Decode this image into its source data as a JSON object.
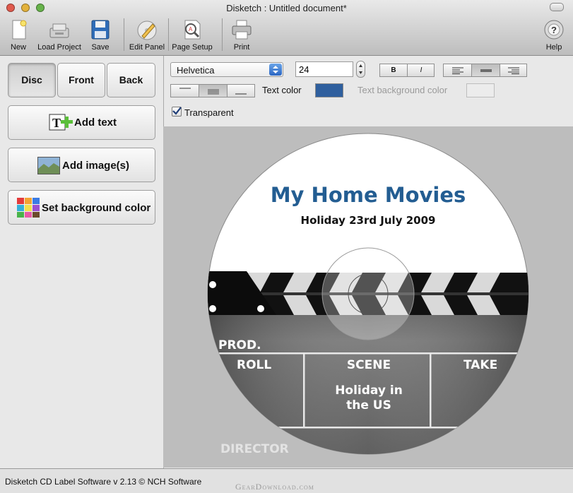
{
  "window": {
    "title": "Disketch : Untitled document*",
    "traffic_colors": [
      "#e05a4d",
      "#e3b23c",
      "#67b34b"
    ]
  },
  "toolbar": {
    "new": {
      "label": "New",
      "icon": "new-document-icon"
    },
    "load": {
      "label": "Load Project",
      "icon": "load-project-icon"
    },
    "save": {
      "label": "Save",
      "icon": "floppy-disk-icon"
    },
    "edit": {
      "label": "Edit Panel",
      "icon": "edit-panel-icon"
    },
    "page_setup": {
      "label": "Page Setup",
      "icon": "page-setup-icon"
    },
    "print": {
      "label": "Print",
      "icon": "printer-icon"
    },
    "help": {
      "label": "Help",
      "icon": "help-icon"
    }
  },
  "left_panel": {
    "views": [
      {
        "label": "Disc",
        "selected": true
      },
      {
        "label": "Front",
        "selected": false
      },
      {
        "label": "Back",
        "selected": false
      }
    ],
    "add_text": "Add text",
    "add_image": "Add image(s)",
    "set_bg": "Set background color"
  },
  "format": {
    "font": "Helvetica",
    "size": "24",
    "bold": "B",
    "italic": "I",
    "text_color_label": "Text color",
    "text_color": "#2f5f9e",
    "text_bg_label": "Text background color",
    "transparent_label": "Transparent",
    "transparent": true,
    "horizontal_align": "center",
    "vertical_align": "center"
  },
  "disc": {
    "title": "My Home Movies",
    "subtitle": "Holiday 23rd July 2009",
    "title_color": "#235d92",
    "clap": {
      "prod": "PROD.",
      "roll": "ROLL",
      "scene": "SCENE",
      "take": "TAKE",
      "scene_value_line1": "Holiday in",
      "scene_value_line2": "the US",
      "director": "DIRECTOR"
    }
  },
  "status": {
    "text": "Disketch CD Label Software v 2.13 © NCH Software",
    "watermark": "GearDownload.com"
  }
}
